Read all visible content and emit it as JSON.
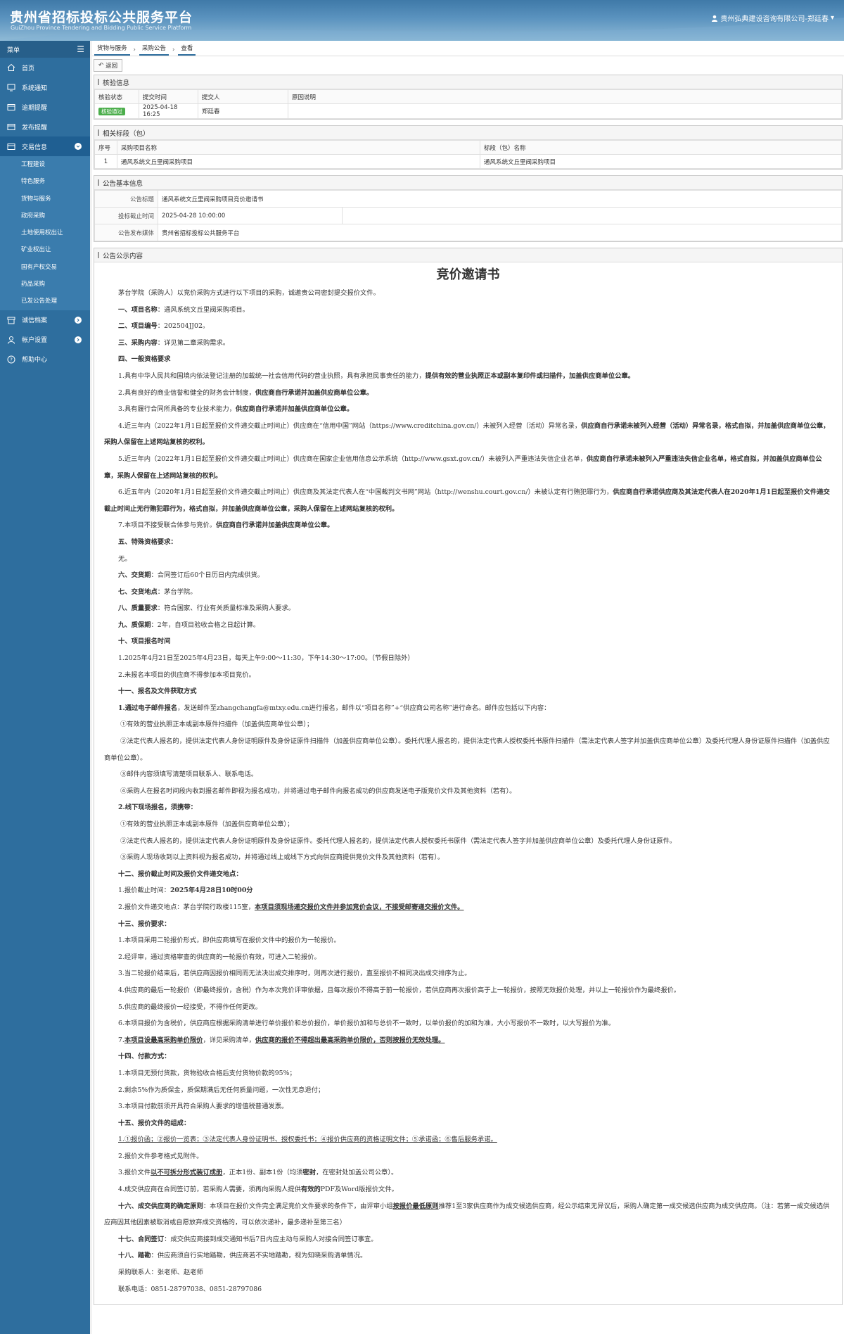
{
  "header": {
    "title": "贵州省招标投标公共服务平台",
    "subtitle": "GuiZhou Province Tendering and Bidding Public Service Platform",
    "user": "贵州弘典建设咨询有限公司-郑廷春"
  },
  "sidebar": {
    "menu_label": "菜单",
    "items": [
      {
        "label": "首页",
        "icon": "home-icon"
      },
      {
        "label": "系统通知",
        "icon": "monitor-icon"
      },
      {
        "label": "逾期提醒",
        "icon": "folder-icon"
      },
      {
        "label": "发布提醒",
        "icon": "folder-icon"
      },
      {
        "label": "交易信息",
        "icon": "folder-icon"
      }
    ],
    "sub_items": [
      "工程建设",
      "特色服务",
      "货物与服务",
      "政府采购",
      "土地使用权出让",
      "矿业权出让",
      "国有产权交易",
      "药品采购",
      "已发公告处理"
    ],
    "bottom_items": [
      {
        "label": "诚信档案",
        "icon": "archive-icon"
      },
      {
        "label": "帐户设置",
        "icon": "user-icon"
      },
      {
        "label": "帮助中心",
        "icon": "help-icon"
      }
    ]
  },
  "breadcrumb": [
    "货物与服务",
    "采购公告",
    "查看"
  ],
  "back_button": "返回",
  "verify": {
    "title": "核验信息",
    "headers": [
      "核验状态",
      "提交时间",
      "提交人",
      "原因说明"
    ],
    "status": "核验通过",
    "time": "2025-04-18 16:25",
    "person": "郑廷春",
    "reason": ""
  },
  "sections": {
    "title": "相关标段（包）",
    "headers": [
      "序号",
      "采购项目名称",
      "标段（包）名称"
    ],
    "rows": [
      {
        "no": "1",
        "project": "通风系统文丘里阀采购项目",
        "section": "通风系统文丘里阀采购项目"
      }
    ]
  },
  "basic": {
    "title": "公告基本信息",
    "rows": [
      {
        "label": "公告标题",
        "value": "通风系统文丘里阀采购项目竞价邀请书"
      },
      {
        "label": "投标截止时间",
        "value": "2025-04-28 10:00:00"
      },
      {
        "label": "公告发布媒体",
        "value": "贵州省招标投标公共服务平台"
      }
    ]
  },
  "content": {
    "title": "公告公示内容",
    "doc_title": "竞价邀请书"
  }
}
